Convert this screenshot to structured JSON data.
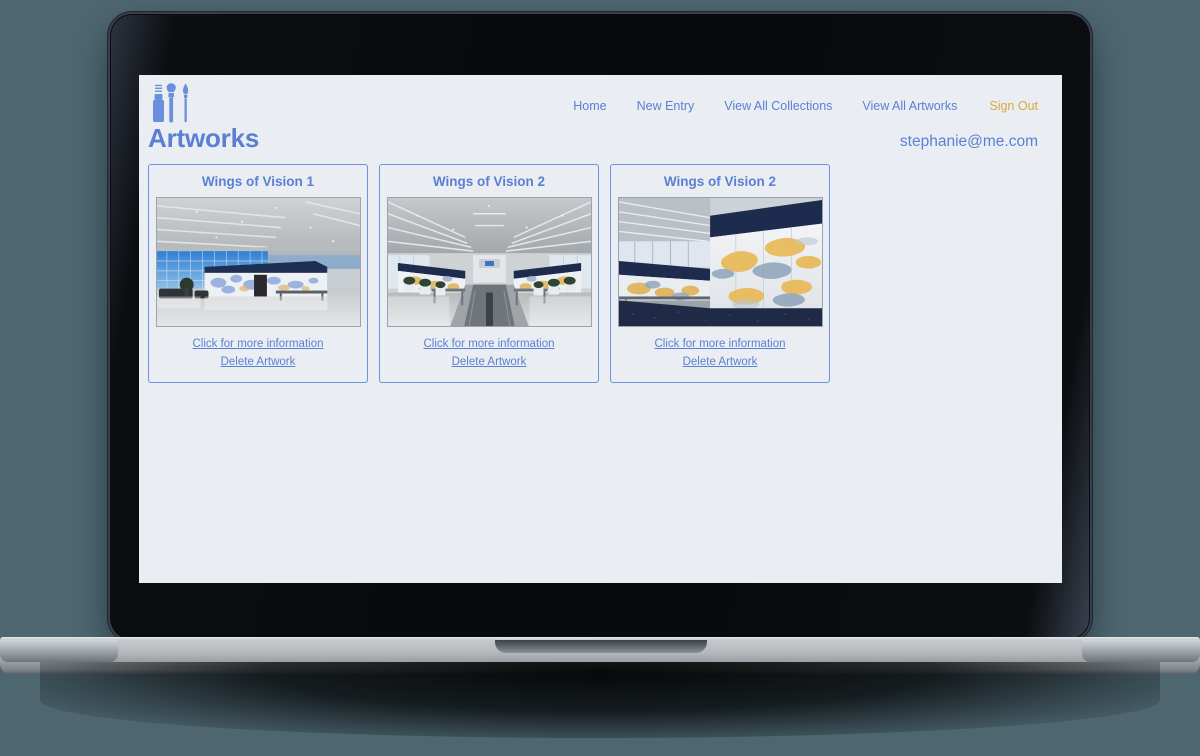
{
  "browser": {
    "device": "laptop-mockup"
  },
  "header": {
    "logo_icon": "paint-tube-and-brushes-icon",
    "nav": [
      {
        "label": "Home",
        "name": "nav-home"
      },
      {
        "label": "New Entry",
        "name": "nav-new-entry"
      },
      {
        "label": "View All Collections",
        "name": "nav-view-all-collections"
      },
      {
        "label": "View All Artworks",
        "name": "nav-view-all-artworks"
      }
    ],
    "sign_out": "Sign Out",
    "sign_out_color": "#d6a83f"
  },
  "page": {
    "title": "Artworks",
    "user_email": "stephanie@me.com",
    "accent_color": "#5b7fd4",
    "background_color": "#eaeef2",
    "card_border_color": "#6a93e0"
  },
  "cards": [
    {
      "title": "Wings of Vision 1",
      "image_alt": "airport-terminal-blue-glass-kiosk",
      "info_link": "Click for more information",
      "delete_link": "Delete Artwork"
    },
    {
      "title": "Wings of Vision 2",
      "image_alt": "airport-corridor-moving-walkway-murals",
      "info_link": "Click for more information",
      "delete_link": "Delete Artwork"
    },
    {
      "title": "Wings of Vision 2",
      "image_alt": "mural-wall-closeup-gold-blue",
      "info_link": "Click for more information",
      "delete_link": "Delete Artwork"
    }
  ]
}
